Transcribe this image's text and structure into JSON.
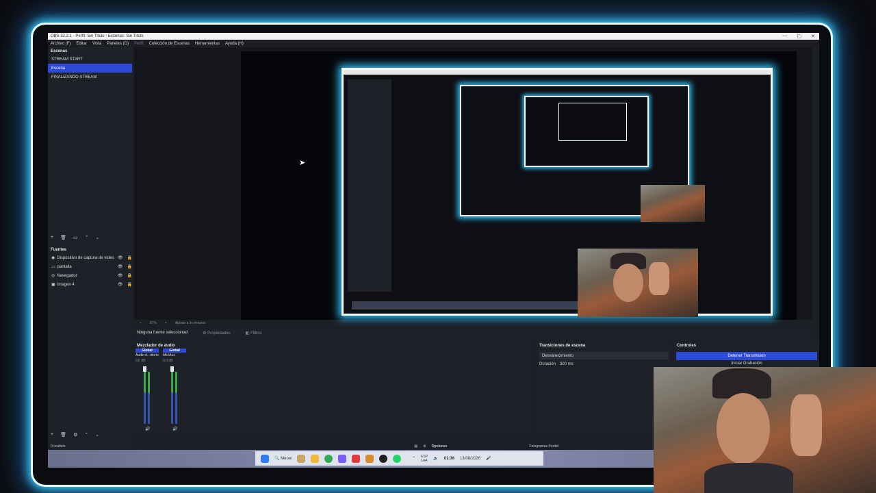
{
  "window": {
    "title": "OBS 32.2.1 - Perfil: Sin Título - Escenas: Sin Título",
    "controls": [
      "—",
      "▢",
      "✕"
    ]
  },
  "menu": [
    "Archivo (F)",
    "Editar",
    "Vista",
    "Paneles (D)",
    "Perfil",
    "Colección de Escenas",
    "Herramientas",
    "Ayuda (H)"
  ],
  "scenes": {
    "title": "Escenas",
    "items": [
      "STREAM START",
      "Escena",
      "FINALIZANDO STREAM"
    ],
    "active_index": 1
  },
  "sources": {
    "title": "Fuentes",
    "items": [
      "Dispositivo de captura de video",
      "pantalla",
      "Navegador",
      "Imagen 4"
    ]
  },
  "toolbar_strip": {
    "zoom": "87%",
    "fit": "Ajustar a la ventana"
  },
  "properties_bar": {
    "none_selected": "Ninguna fuente seleccionad",
    "properties": "Propiedades",
    "filters": "Filtros"
  },
  "mixer": {
    "title": "Mezclador de audio",
    "channels": [
      {
        "header": "Global",
        "name": "Audio d...ritorio",
        "db": "0.0 dB"
      },
      {
        "header": "Global",
        "name": "Mic/Aux",
        "db": "0.0 dB"
      }
    ],
    "hidden": "0 oculto/s",
    "options": "Opciones"
  },
  "transitions": {
    "title": "Transiciones de escena",
    "selected": "Desvanecimiento",
    "duration_label": "Duración",
    "duration_value": "300 ms"
  },
  "controls": {
    "title": "Controles",
    "stop_stream": "Detener Transmisión",
    "start_recording": "Iniciar Grabación"
  },
  "status": {
    "frames": "Fotogramas Perdid"
  },
  "taskbar": {
    "search": "Meow",
    "lang_top": "ESP",
    "lang_bottom": "LAA",
    "time": "01:36",
    "date": "13/08/2026"
  },
  "colors": {
    "accent": "#2c4ad6",
    "glow": "#31c7ff",
    "panel": "#1f2128",
    "background": "#0b0c0f"
  }
}
